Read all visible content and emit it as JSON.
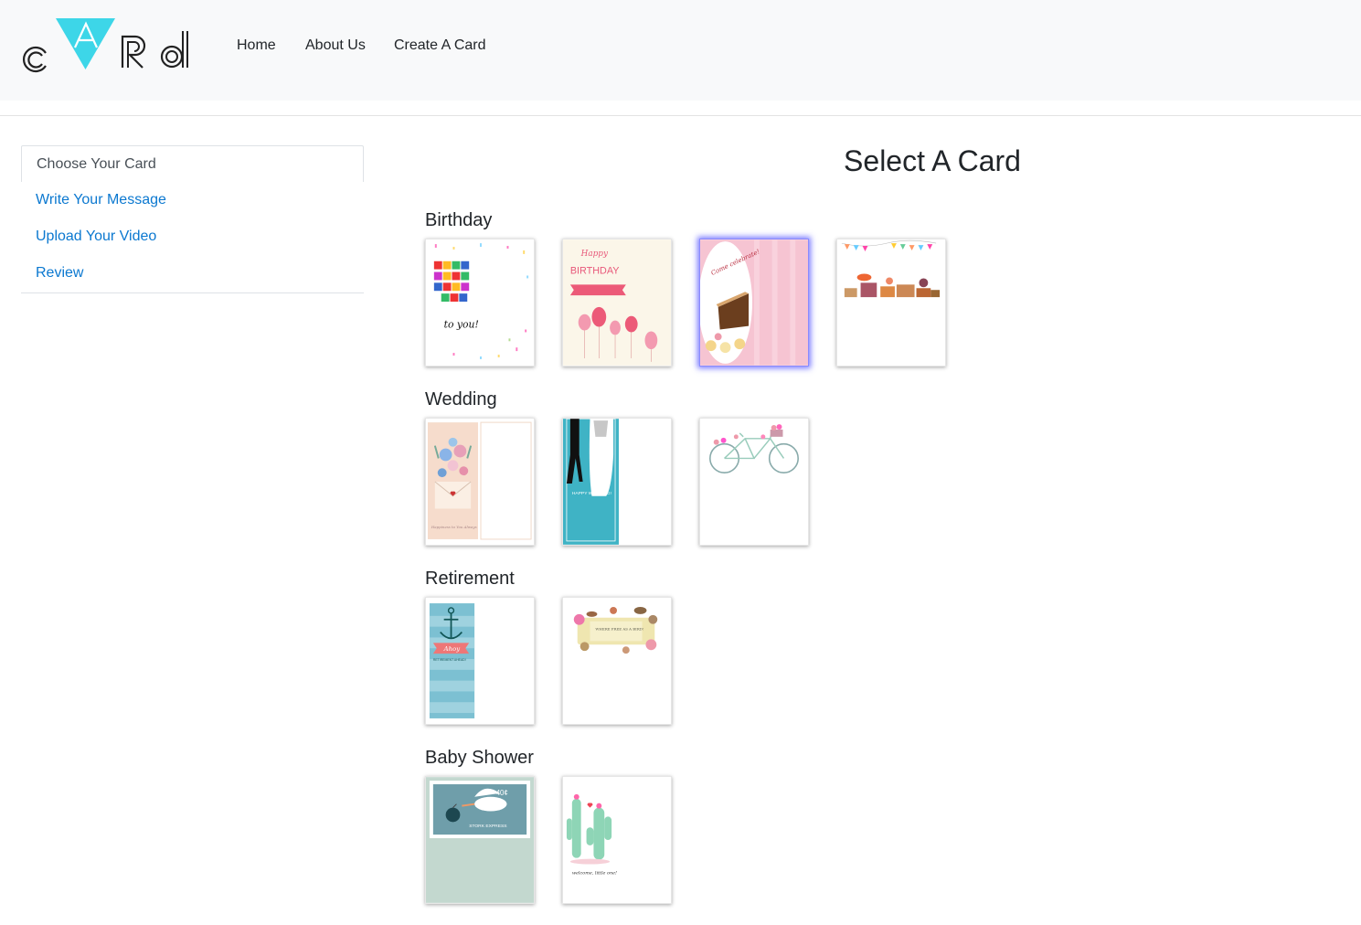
{
  "brand": {
    "logo_text": "cARd",
    "accent": "#3dd6e8"
  },
  "nav": {
    "items": [
      "Home",
      "About Us",
      "Create A Card"
    ]
  },
  "steps": {
    "items": [
      "Choose Your Card",
      "Write Your Message",
      "Upload Your Video",
      "Review"
    ],
    "active_index": 0
  },
  "main": {
    "title": "Select A Card"
  },
  "categories": [
    {
      "name": "Birthday",
      "cards": [
        "happy-birthday-to-you",
        "happy-birthday-balloons",
        "come-celebrate-cake",
        "birthday-bunting-party"
      ],
      "selected_index": 2
    },
    {
      "name": "Wedding",
      "cards": [
        "floral-envelope-happiness",
        "happy-wedding-couple",
        "bicycle-with-flowers"
      ]
    },
    {
      "name": "Retirement",
      "cards": [
        "ahoy-anchor-retirement",
        "wreath-with-birds"
      ]
    },
    {
      "name": "Baby Shower",
      "cards": [
        "stork-express-stamp",
        "cactus-welcome-little-one"
      ]
    }
  ],
  "card_art_text": {
    "bday1": "to you!",
    "bday2_happy": "Happy",
    "bday2_birthday": "BIRTHDAY",
    "bday3": "Come celebrate!",
    "wed1": "Happiness to You Always",
    "wed2": "HAPPY WEDDING!",
    "ret1_ahoy": "Ahoy",
    "ret1_sub": "RETIREMENT AHEAD!",
    "ret2": "WHERE FREE AS A BIRD!",
    "baby1_price": "40¢",
    "baby1_label": "STORK EXPRESS",
    "baby2": "welcome, little one!"
  }
}
